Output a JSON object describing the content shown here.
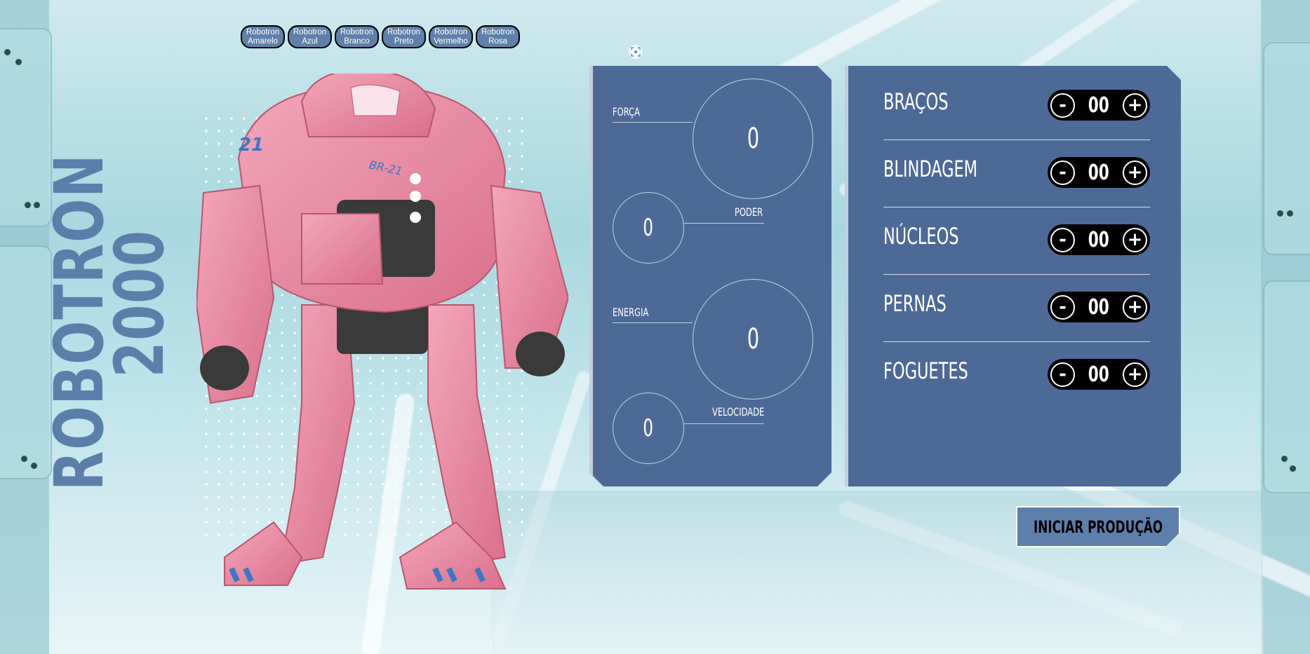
{
  "brand": {
    "line1": "ROBOTRON",
    "line2": "2000"
  },
  "variants": [
    {
      "line1": "Robotron",
      "line2": "Amarelo"
    },
    {
      "line1": "Robotron",
      "line2": "Azul"
    },
    {
      "line1": "Robotron",
      "line2": "Branco"
    },
    {
      "line1": "Robotron",
      "line2": "Preto"
    },
    {
      "line1": "Robotron",
      "line2": "Vermelho"
    },
    {
      "line1": "Robotron",
      "line2": "Rosa"
    }
  ],
  "robot": {
    "badge": "BR-21",
    "number": "21",
    "color": "#e88aa2"
  },
  "stats": {
    "forca": {
      "label": "FORÇA",
      "value": "0"
    },
    "poder": {
      "label": "PODER",
      "value": "0"
    },
    "energia": {
      "label": "ENERGIA",
      "value": "0"
    },
    "velocidade": {
      "label": "VELOCIDADE",
      "value": "0"
    }
  },
  "parts": [
    {
      "label": "BRAÇOS",
      "value": "00",
      "minus": "-",
      "plus": "+"
    },
    {
      "label": "BLINDAGEM",
      "value": "00",
      "minus": "-",
      "plus": "+"
    },
    {
      "label": "NÚCLEOS",
      "value": "00",
      "minus": "-",
      "plus": "+"
    },
    {
      "label": "PERNAS",
      "value": "00",
      "minus": "-",
      "plus": "+"
    },
    {
      "label": "FOGUETES",
      "value": "00",
      "minus": "-",
      "plus": "+"
    }
  ],
  "cta": {
    "label": "INICIAR PRODUÇÃO"
  },
  "colors": {
    "panel": "#4d6a97",
    "accent": "#5f7fab",
    "title": "#5b7fa9"
  }
}
